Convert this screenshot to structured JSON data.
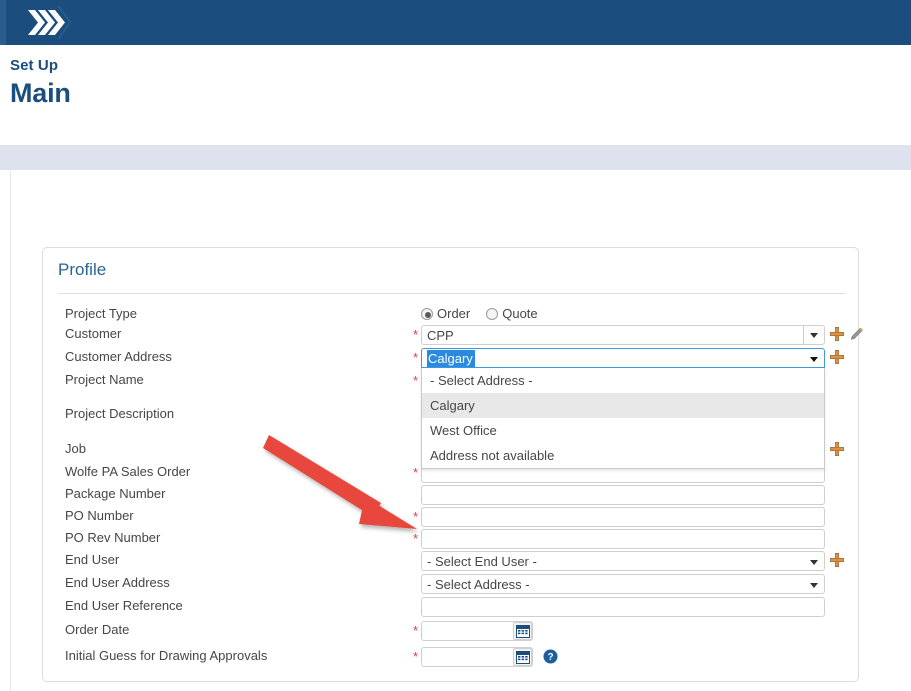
{
  "header": {
    "logo_icon": "chevrons-logo",
    "bar_color": "#1b4e7e"
  },
  "page": {
    "eyebrow": "Set Up",
    "title": "Main"
  },
  "panel": {
    "title": "Profile"
  },
  "form": {
    "rows": [
      {
        "label": "Project Type",
        "required": false,
        "type": "radio"
      },
      {
        "label": "Customer",
        "required": true,
        "type": "combo",
        "value": "CPP"
      },
      {
        "label": "Customer Address",
        "required": true,
        "type": "select-open",
        "value": "Calgary"
      },
      {
        "label": "Project Name",
        "required": true,
        "type": "text",
        "value": ""
      },
      {
        "label": "Project Description",
        "required": false,
        "type": "textarea",
        "value": ""
      },
      {
        "label": "Job",
        "required": false,
        "type": "plusonly"
      },
      {
        "label": "Wolfe PA Sales Order",
        "required": true,
        "type": "text",
        "value": ""
      },
      {
        "label": "Package Number",
        "required": false,
        "type": "text",
        "value": ""
      },
      {
        "label": "PO Number",
        "required": true,
        "type": "text",
        "value": ""
      },
      {
        "label": "PO Rev Number",
        "required": true,
        "type": "text",
        "value": ""
      },
      {
        "label": "End User",
        "required": false,
        "type": "select",
        "value": "- Select End User -"
      },
      {
        "label": "End User Address",
        "required": false,
        "type": "select",
        "value": "- Select Address -"
      },
      {
        "label": "End User Reference",
        "required": false,
        "type": "text",
        "value": ""
      },
      {
        "label": "Order Date",
        "required": true,
        "type": "date",
        "value": ""
      },
      {
        "label": "Initial Guess for Drawing Approvals",
        "required": true,
        "type": "date-help",
        "value": ""
      }
    ],
    "required_marker": "*"
  },
  "project_type": {
    "options": [
      {
        "label": "Order",
        "selected": true
      },
      {
        "label": "Quote",
        "selected": false
      }
    ]
  },
  "customer_address_dropdown": {
    "selected_value": "Calgary",
    "options": [
      {
        "label": "- Select Address -",
        "highlighted": false
      },
      {
        "label": "Calgary",
        "highlighted": true
      },
      {
        "label": "West Office",
        "highlighted": false
      },
      {
        "label": "Address not available",
        "highlighted": false
      }
    ]
  },
  "icons": {
    "add_icon": "plus-icon",
    "edit_icon": "pencil-icon",
    "calendar_icon": "calendar-icon",
    "help_icon": "help-icon",
    "caret_icon": "chevron-down-icon"
  },
  "annotation": {
    "arrow_icon": "red-arrow-annotation",
    "arrow_color": "#e8463c"
  },
  "colors": {
    "brand_blue": "#1b4e7e",
    "panel_title_blue": "#2a6496",
    "required_red": "#e04040",
    "accent_orange": "#e3913f",
    "band": "#dde2ee",
    "select_highlight": "#2a8ae0"
  }
}
